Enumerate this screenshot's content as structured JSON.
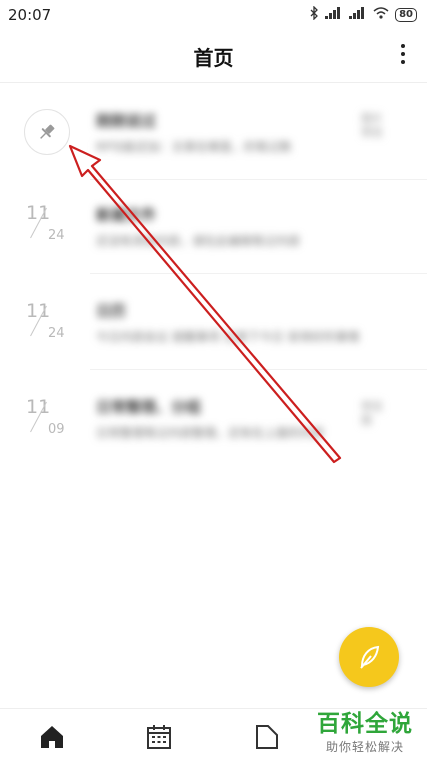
{
  "status": {
    "time": "20:07",
    "battery": "80"
  },
  "header": {
    "title": "首页"
  },
  "notes": [
    {
      "pinned": true,
      "title": "刚刚说过",
      "snippet": "RP功能还加：文章在哪里，的笔记数",
      "thumb": "图片 预览"
    },
    {
      "date_m": "11",
      "date_d": "24",
      "title": "新建文件",
      "snippet": "还没有添加内容，请在此编辑笔记内容"
    },
    {
      "date_m": "11",
      "date_d": "24",
      "title": "日历",
      "snippet": "今日内容会议 提醒事项 记录下今日 安排好的事情"
    },
    {
      "date_m": "11",
      "date_d": "09",
      "title": "日常整理、分组",
      "snippet": "日常整理笔记内容整理，还有在上面的内容",
      "thumb": "预览 图"
    }
  ],
  "nav": [
    "home-icon",
    "calendar-icon",
    "folder-icon"
  ],
  "watermark": {
    "big": "百科全说",
    "small": "助你轻松解决"
  },
  "colors": {
    "fab": "#f5c81c",
    "annotation": "#cc1f1f",
    "watermark": "#2fa63a"
  }
}
